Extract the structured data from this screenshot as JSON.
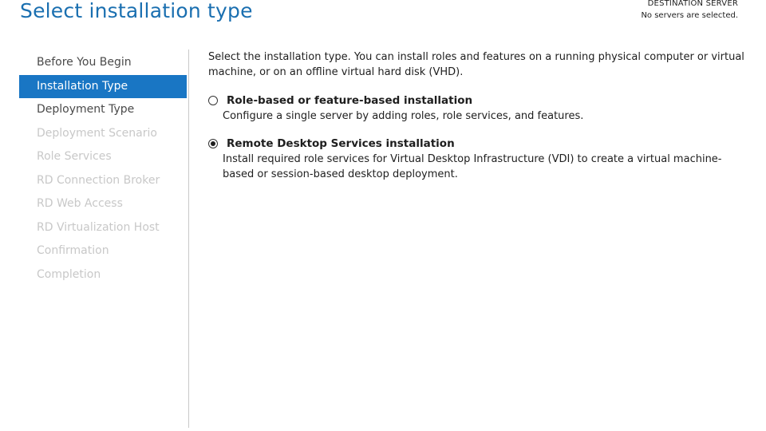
{
  "header": {
    "title": "Select installation type",
    "destination_label": "DESTINATION SERVER",
    "destination_value": "No servers are selected."
  },
  "nav": {
    "items": [
      {
        "label": "Before You Begin",
        "state": "done"
      },
      {
        "label": "Installation Type",
        "state": "active"
      },
      {
        "label": "Deployment Type",
        "state": "done"
      },
      {
        "label": "Deployment Scenario",
        "state": "disabled"
      },
      {
        "label": "Role Services",
        "state": "disabled"
      },
      {
        "label": "RD Connection Broker",
        "state": "disabled"
      },
      {
        "label": "RD Web Access",
        "state": "disabled"
      },
      {
        "label": "RD Virtualization Host",
        "state": "disabled"
      },
      {
        "label": "Confirmation",
        "state": "disabled"
      },
      {
        "label": "Completion",
        "state": "disabled"
      }
    ]
  },
  "main": {
    "intro": "Select the installation type. You can install roles and features on a running physical computer or virtual machine, or on an offline virtual hard disk (VHD).",
    "options": [
      {
        "title": "Role-based or feature-based installation",
        "description": "Configure a single server by adding roles, role services, and features.",
        "selected": false
      },
      {
        "title": "Remote Desktop Services installation",
        "description": "Install required role services for Virtual Desktop Infrastructure (VDI) to create a virtual machine-based or session-based desktop deployment.",
        "selected": true
      }
    ]
  },
  "colors": {
    "accent": "#1976c4",
    "title": "#1a6fb0",
    "disabled_text": "#c8c8c8"
  }
}
